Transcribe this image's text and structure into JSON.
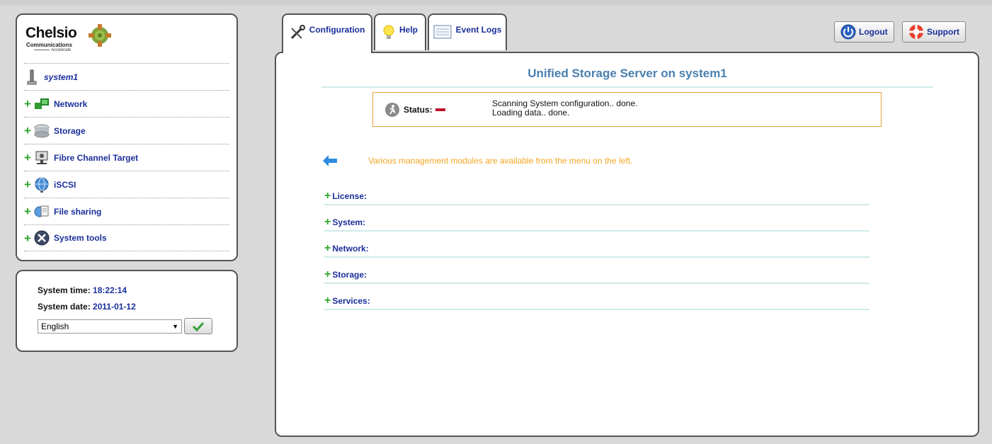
{
  "logo": {
    "name": "Chelsio",
    "sub": "Communications",
    "tagline": "Accelerate"
  },
  "nav": {
    "host": "system1",
    "items": [
      {
        "label": "Network",
        "icon": "network-icon"
      },
      {
        "label": "Storage",
        "icon": "storage-disk-icon"
      },
      {
        "label": "Fibre Channel Target",
        "icon": "fibre-channel-icon"
      },
      {
        "label": "iSCSI",
        "icon": "globe-icon"
      },
      {
        "label": "File sharing",
        "icon": "file-sharing-icon"
      },
      {
        "label": "System tools",
        "icon": "tools-icon"
      }
    ]
  },
  "time": {
    "time_label": "System time:",
    "time_value": "18:22:14",
    "date_label": "System date:",
    "date_value": "2011-01-12",
    "language": "English"
  },
  "tabs": [
    {
      "label": "Configuration",
      "icon": "wrench-screwdriver-icon",
      "active": true
    },
    {
      "label": "Help",
      "icon": "lightbulb-icon",
      "active": false
    },
    {
      "label": "Event Logs",
      "icon": "log-list-icon",
      "active": false
    }
  ],
  "toolbar": {
    "logout_label": "Logout",
    "support_label": "Support"
  },
  "main": {
    "title": "Unified Storage Server on  system1",
    "status_label": "Status:",
    "status_lines": [
      "Scanning System configuration.. done.",
      "Loading data.. done."
    ],
    "info_text": "Various management modules are available from the menu on the left.",
    "sections": [
      "License:",
      "System:",
      "Network:",
      "Storage:",
      "Services:"
    ]
  },
  "colors": {
    "link": "#1a2e9a",
    "title": "#4a7fae",
    "info": "#f5a623",
    "status_border": "#e8a33c",
    "plus": "#2fa52f"
  }
}
